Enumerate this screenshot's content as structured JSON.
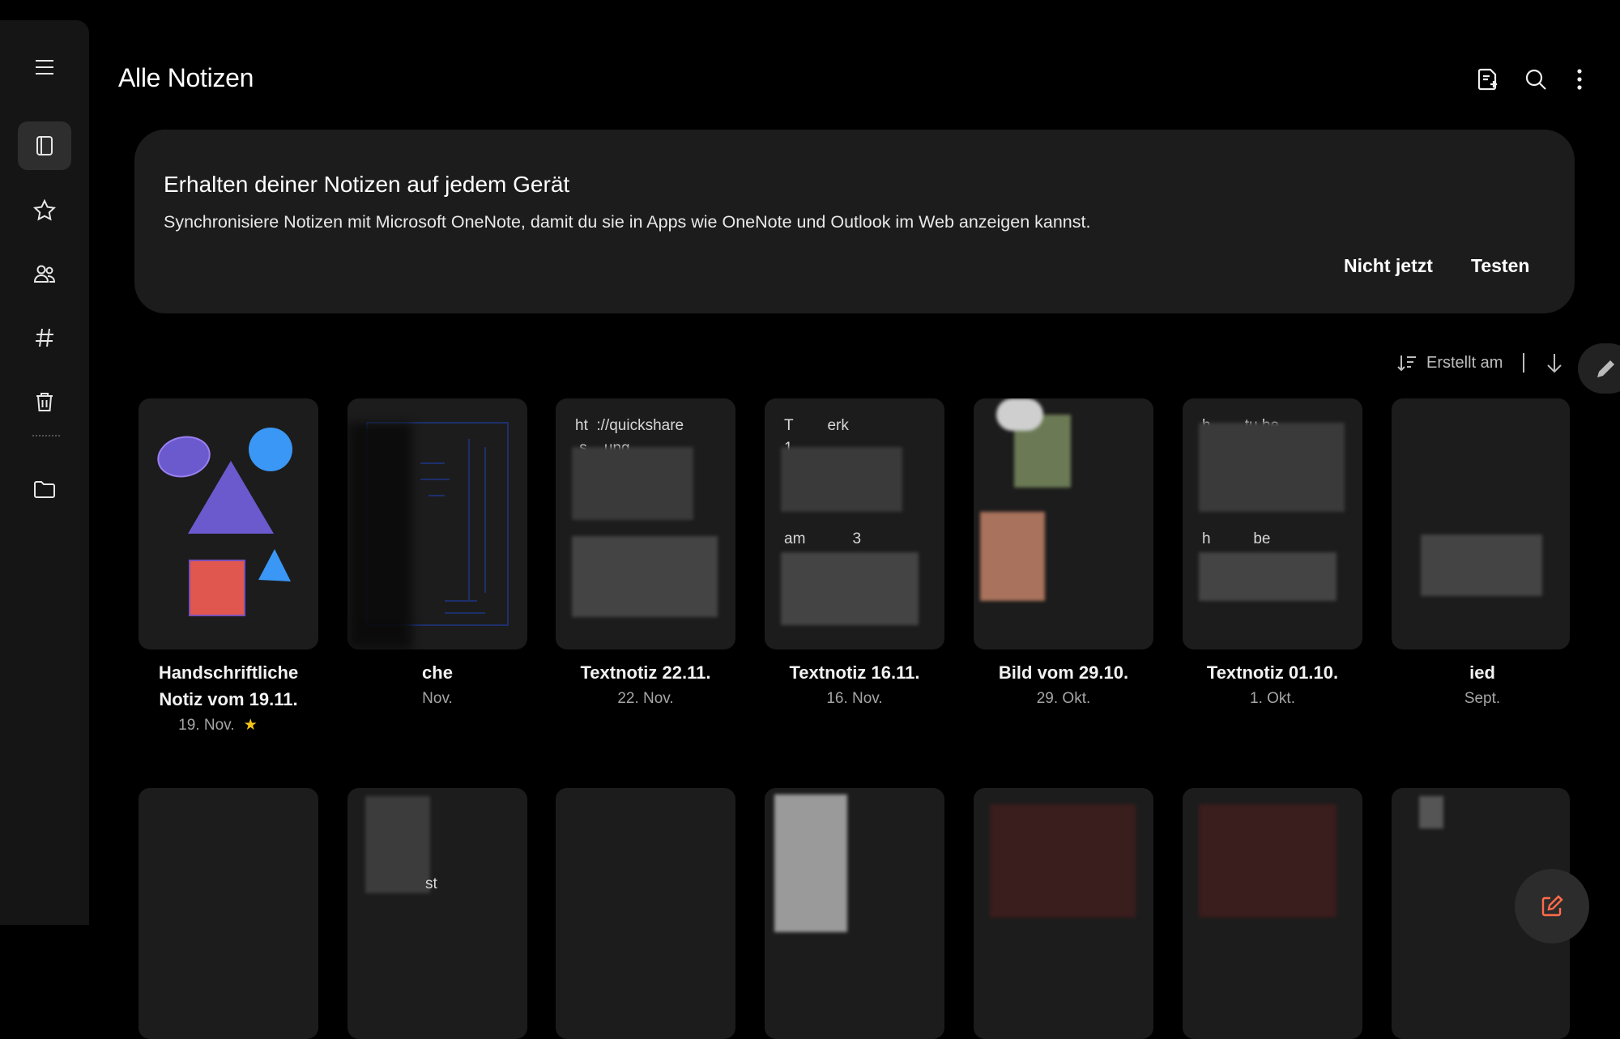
{
  "header": {
    "title": "Alle Notizen",
    "icons": [
      "pdf-add-icon",
      "search-icon",
      "more-vert-icon"
    ]
  },
  "rail": {
    "items": [
      {
        "name": "menu-icon"
      },
      {
        "name": "notes-icon",
        "active": true
      },
      {
        "name": "star-icon"
      },
      {
        "name": "shared-people-icon"
      },
      {
        "name": "hashtag-icon"
      },
      {
        "name": "trash-icon"
      },
      {
        "name": "folder-icon"
      }
    ]
  },
  "banner": {
    "title": "Erhalten deiner Notizen auf jedem Gerät",
    "text": "Synchronisiere Notizen mit Microsoft OneNote, damit du sie in Apps wie OneNote und Outlook im Web anzeigen kannst.",
    "dismiss_label": "Nicht jetzt",
    "try_label": "Testen"
  },
  "sort": {
    "label": "Erstellt am"
  },
  "notes": [
    {
      "title_line1": "Handschriftliche",
      "title_line2": "Notiz vom 19.11.",
      "date": "19. Nov.",
      "favorite": true
    },
    {
      "title_line1": "che",
      "date": "Nov."
    },
    {
      "title_line1": "Textnotiz 22.11.",
      "date": "22. Nov.",
      "preview": "ht  ://quickshare\n.s    ung\n\n\n\n\n\nN          Mq"
    },
    {
      "title_line1": "Textnotiz 16.11.",
      "date": "16. Nov.",
      "preview": "T        erk\n1\n\n\n\nam           3\nge\n1        n"
    },
    {
      "title_line1": "Bild vom 29.10.",
      "date": "29. Okt."
    },
    {
      "title_line1": "Textnotiz 01.10.",
      "date": "1. Okt.",
      "preview": "h        tu.be\n\n\n\n\nh          be\n               =\nC         S  vkla"
    },
    {
      "title_line1": "ied",
      "date": "Sept."
    }
  ],
  "second_row_text": "st",
  "colors": {
    "background": "#000000",
    "surface": "#1c1c1c",
    "favorite": "#f5c518",
    "purple": "#6a5acd",
    "blue": "#3a97f5",
    "red": "#e0574f"
  }
}
